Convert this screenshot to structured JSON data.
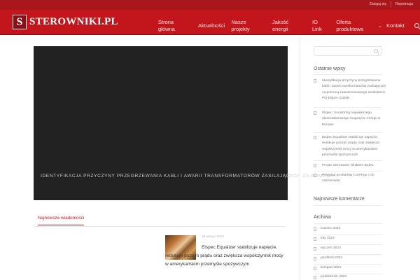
{
  "topbar": {
    "links": [
      "Zaloguj się",
      "Rejestracja"
    ]
  },
  "header": {
    "logo_mark": "S",
    "logo_text": "STEROWNIKI.PL",
    "nav": [
      {
        "label": "Strona główna"
      },
      {
        "label": "Aktualności"
      },
      {
        "label": "Nasze projekty"
      },
      {
        "label": "Jakość energii"
      },
      {
        "label": "IO Link"
      },
      {
        "label": "Oferta produktowa"
      },
      {
        "label": "Kontakt"
      }
    ]
  },
  "slider": {
    "caption": "Identyfikacja przyczyny przegrzewania kabli i awarii transformatorów zasilających za pomoc"
  },
  "tabs": {
    "active": "Najnowsze wiadomości"
  },
  "news": {
    "date": "28 lutego 2023",
    "title": "Elspec Equalizer stabilizuje napięcie, redukuje poziom prądu oraz zwiększa współczynnik mocy w amerykańskim przemyśle spożywczym"
  },
  "sidebar": {
    "recent_heading": "Ostatnie wpisy",
    "recent_posts": [
      "Identyfikacja przyczyny przegrzewania kabli i awarii transformatorów zasilających za pomocą zaawansowanego analizatora PQ Elspec G4500",
      "Elspec: monitoring największego akumulatorowego magazynu energii w Europie",
      "Elspec Equalizer stabilizuje napięcie, redukuje poziom prądu oraz zwiększa współczynnik mocy w amerykańskim przemyśle spożywczym",
      "Proste sterowanie silnikiem BLDC",
      "Przegląd produktów CoreTigo i ich zastosowań"
    ],
    "comments_heading": "Najnowsze komentarze",
    "archive_heading": "Archiwa",
    "archives": [
      "marzec 2023",
      "luty 2023",
      "styczeń 2023",
      "grudzień 2022",
      "listopad 2022",
      "październik 2022"
    ]
  },
  "colors": {
    "brand_red": "#c3161c",
    "dark_red": "#a8171c",
    "slider_bg": "#212121"
  }
}
